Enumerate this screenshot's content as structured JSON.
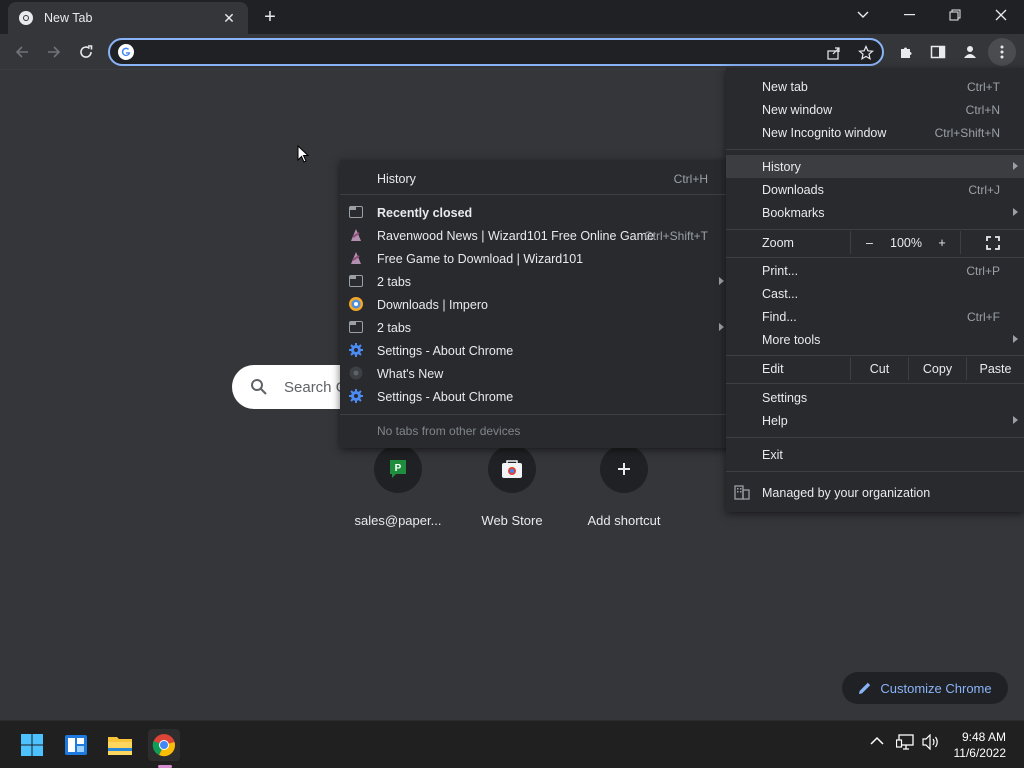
{
  "browser": {
    "tab": {
      "title": "New Tab"
    },
    "omnibox": {
      "value": "",
      "placeholder": ""
    }
  },
  "ntp": {
    "search_placeholder": "Search G",
    "shortcuts": [
      {
        "label": "sales@paper..."
      },
      {
        "label": "Web Store"
      },
      {
        "label": "Add shortcut"
      }
    ],
    "customize_label": "Customize Chrome"
  },
  "history_menu": {
    "header": {
      "label": "History",
      "shortcut": "Ctrl+H"
    },
    "recently_closed": "Recently closed",
    "items": [
      {
        "label": "Ravenwood News | Wizard101 Free Online Game",
        "shortcut": "Ctrl+Shift+T",
        "icon": "wizard101-favicon"
      },
      {
        "label": "Free Game to Download | Wizard101",
        "shortcut": "",
        "icon": "wizard101-favicon"
      },
      {
        "label": "2 tabs",
        "shortcut": "",
        "icon": "tabs-icon",
        "submenu": true
      },
      {
        "label": "Downloads | Impero",
        "shortcut": "",
        "icon": "impero-favicon"
      },
      {
        "label": "2 tabs",
        "shortcut": "",
        "icon": "tabs-icon",
        "submenu": true
      },
      {
        "label": "Settings - About Chrome",
        "shortcut": "",
        "icon": "settings-gear-icon"
      },
      {
        "label": "What's New",
        "shortcut": "",
        "icon": "chrome-favicon"
      },
      {
        "label": "Settings - About Chrome",
        "shortcut": "",
        "icon": "settings-gear-icon"
      }
    ],
    "footer": "No tabs from other devices"
  },
  "main_menu": {
    "group1": [
      {
        "label": "New tab",
        "shortcut": "Ctrl+T"
      },
      {
        "label": "New window",
        "shortcut": "Ctrl+N"
      },
      {
        "label": "New Incognito window",
        "shortcut": "Ctrl+Shift+N"
      }
    ],
    "group2": [
      {
        "label": "History",
        "shortcut": "",
        "submenu": true
      },
      {
        "label": "Downloads",
        "shortcut": "Ctrl+J"
      },
      {
        "label": "Bookmarks",
        "shortcut": "",
        "submenu": true
      }
    ],
    "zoom": {
      "label": "Zoom",
      "minus": "–",
      "value": "100%",
      "plus": "+"
    },
    "group3": [
      {
        "label": "Print...",
        "shortcut": "Ctrl+P"
      },
      {
        "label": "Cast...",
        "shortcut": ""
      },
      {
        "label": "Find...",
        "shortcut": "Ctrl+F"
      },
      {
        "label": "More tools",
        "shortcut": "",
        "submenu": true
      }
    ],
    "edit": {
      "label": "Edit",
      "cut": "Cut",
      "copy": "Copy",
      "paste": "Paste"
    },
    "group4": [
      {
        "label": "Settings",
        "shortcut": ""
      },
      {
        "label": "Help",
        "shortcut": "",
        "submenu": true
      }
    ],
    "exit": "Exit",
    "managed": "Managed by your organization"
  },
  "taskbar": {
    "time": "9:48 AM",
    "date": "11/6/2022"
  },
  "colors": {
    "accent": "#8ab4f8",
    "menu_bg": "#292a2d",
    "highlight": "#3c3d41",
    "page_bg": "#35363a"
  }
}
